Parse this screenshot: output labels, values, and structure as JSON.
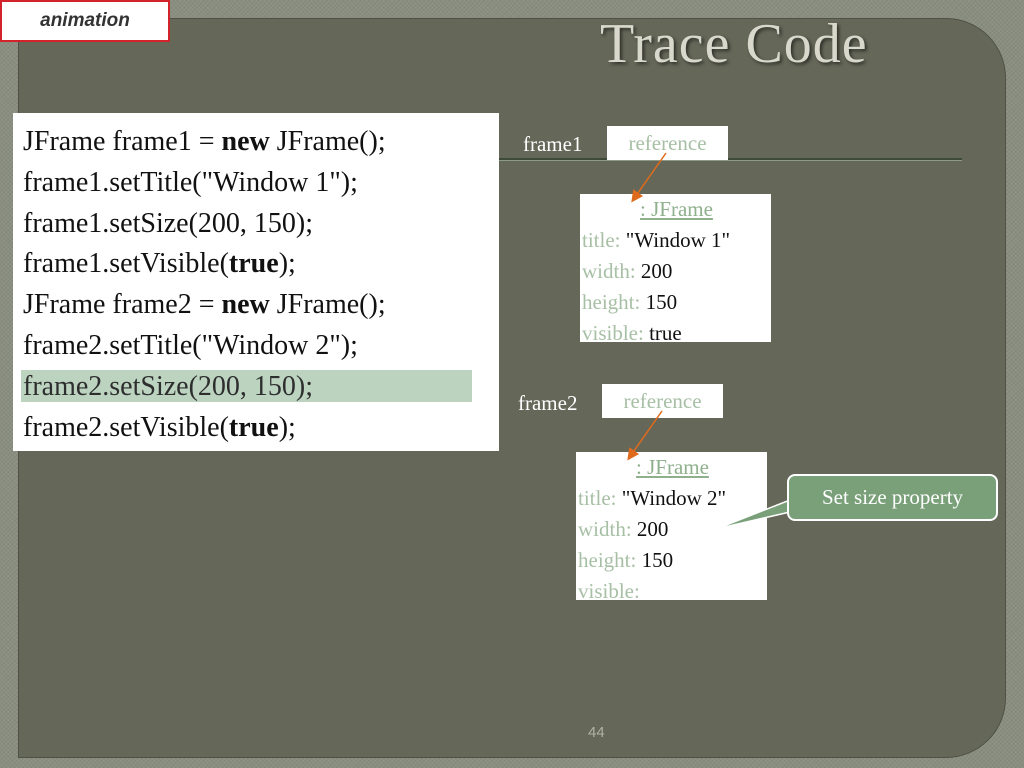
{
  "tag": "animation",
  "title": "Trace Code",
  "code": [
    {
      "parts": [
        {
          "t": "JFrame frame1 = ",
          "b": false
        },
        {
          "t": "new",
          "b": true
        },
        {
          "t": " JFrame();",
          "b": false
        }
      ]
    },
    {
      "parts": [
        {
          "t": "frame1.setTitle(\"Window 1\");",
          "b": false
        }
      ]
    },
    {
      "parts": [
        {
          "t": "frame1.setSize(200, 150);",
          "b": false
        }
      ]
    },
    {
      "parts": [
        {
          "t": "frame1.setVisible(",
          "b": false
        },
        {
          "t": "true",
          "b": true
        },
        {
          "t": ");",
          "b": false
        }
      ]
    },
    {
      "parts": [
        {
          "t": "JFrame frame2 = ",
          "b": false
        },
        {
          "t": "new",
          "b": true
        },
        {
          "t": " JFrame();",
          "b": false
        }
      ]
    },
    {
      "parts": [
        {
          "t": "frame2.setTitle(\"Window 2\");",
          "b": false
        }
      ]
    },
    {
      "parts": [
        {
          "t": "frame2.setSize(200, 150);",
          "b": false
        }
      ],
      "highlight": true
    },
    {
      "parts": [
        {
          "t": "frame2.setVisible(",
          "b": false
        },
        {
          "t": "true",
          "b": true
        },
        {
          "t": ");",
          "b": false
        }
      ]
    }
  ],
  "frame1": {
    "var": "frame1",
    "ref": "reference",
    "obj": {
      "header": ": JFrame",
      "rows": [
        {
          "k": "title:",
          "v": "\"Window 1\""
        },
        {
          "k": "width:",
          "v": "200"
        },
        {
          "k": "height:",
          "v": "150"
        },
        {
          "k": "visible:",
          "v": "true"
        }
      ]
    }
  },
  "frame2": {
    "var": "frame2",
    "ref": "reference",
    "obj": {
      "header": ": JFrame",
      "rows": [
        {
          "k": "title:",
          "v": "\"Window 2\""
        },
        {
          "k": "width:",
          "v": "200"
        },
        {
          "k": "height:",
          "v": "150"
        },
        {
          "k": "visible:",
          "v": ""
        }
      ]
    }
  },
  "callout": "Set size property",
  "page_number": "44",
  "colors": {
    "slide_bg": "#656759",
    "highlight": "#bcd3c0",
    "arrow": "#e06a1b",
    "callout": "#7aa07a"
  }
}
